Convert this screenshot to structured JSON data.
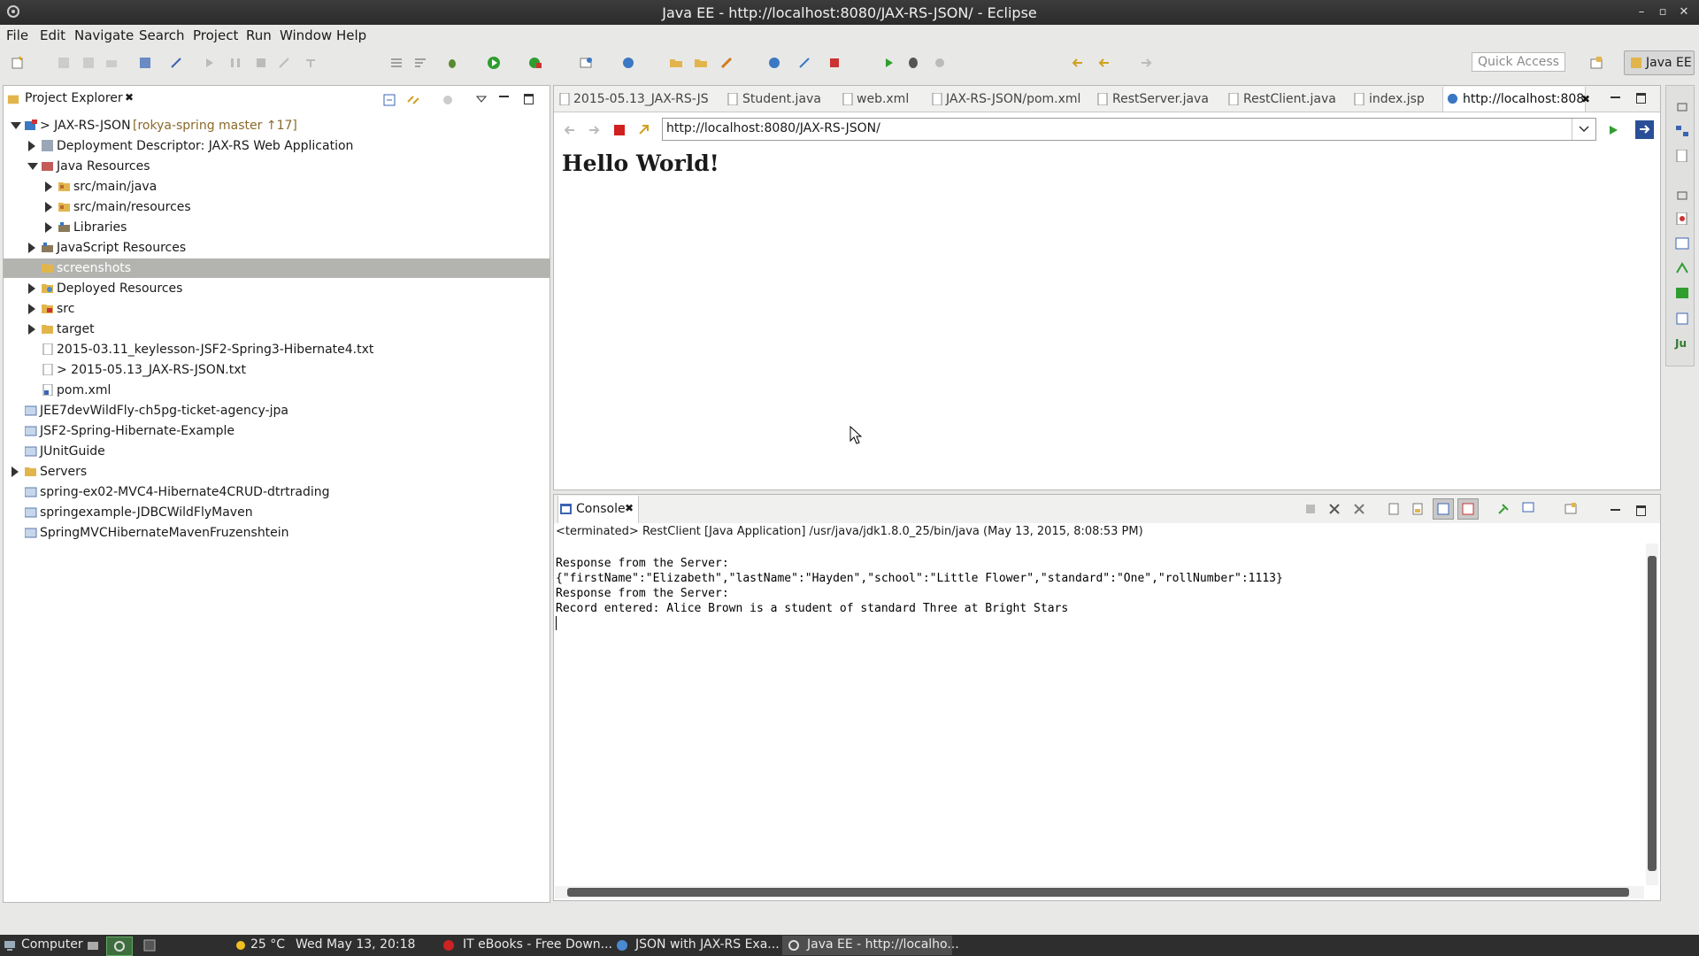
{
  "window": {
    "title": "Java EE - http://localhost:8080/JAX-RS-JSON/ - Eclipse"
  },
  "menu": [
    "File",
    "Edit",
    "Navigate",
    "Search",
    "Project",
    "Run",
    "Window",
    "Help"
  ],
  "toolbar": {
    "quick_access_placeholder": "Quick Access",
    "perspective": "Java EE"
  },
  "project_explorer": {
    "tab_label": "Project Explorer",
    "items": [
      {
        "label": "> JAX-RS-JSON",
        "extra": "[rokya-spring master ↑17]"
      },
      {
        "label": "Deployment Descriptor: JAX-RS Web Application"
      },
      {
        "label": "Java Resources"
      },
      {
        "label": "src/main/java"
      },
      {
        "label": "src/main/resources"
      },
      {
        "label": "Libraries"
      },
      {
        "label": "JavaScript Resources"
      },
      {
        "label": "screenshots"
      },
      {
        "label": "Deployed Resources"
      },
      {
        "label": "src"
      },
      {
        "label": "target"
      },
      {
        "label": "2015-03.11_keylesson-JSF2-Spring3-Hibernate4.txt"
      },
      {
        "label": "> 2015-05.13_JAX-RS-JSON.txt"
      },
      {
        "label": "pom.xml"
      },
      {
        "label": "JEE7devWildFly-ch5pg-ticket-agency-jpa"
      },
      {
        "label": "JSF2-Spring-Hibernate-Example"
      },
      {
        "label": "JUnitGuide"
      },
      {
        "label": "Servers"
      },
      {
        "label": "spring-ex02-MVC4-Hibernate4CRUD-dtrtrading"
      },
      {
        "label": "springexample-JDBCWildFlyMaven"
      },
      {
        "label": "SpringMVCHibernateMavenFruzenshtein"
      }
    ]
  },
  "editor": {
    "tabs": [
      "2015-05.13_JAX-RS-JS",
      "Student.java",
      "web.xml",
      "JAX-RS-JSON/pom.xml",
      "RestServer.java",
      "RestClient.java",
      "index.jsp",
      "http://localhost:808"
    ],
    "url": "http://localhost:8080/JAX-RS-JSON/",
    "page_heading": "Hello World!"
  },
  "console": {
    "tab_label": "Console",
    "status": "<terminated> RestClient [Java Application] /usr/java/jdk1.8.0_25/bin/java (May 13, 2015, 8:08:53 PM)",
    "lines": [
      "Response from the Server:",
      "{\"firstName\":\"Elizabeth\",\"lastName\":\"Hayden\",\"school\":\"Little Flower\",\"standard\":\"One\",\"rollNumber\":1113}",
      "Response from the Server:",
      "Record entered: Alice Brown is a student of standard Three at Bright Stars"
    ]
  },
  "taskbar": {
    "start": "Computer",
    "weather": "25 °C",
    "clock": "Wed May 13, 20:18",
    "windows": [
      "IT eBooks - Free Down...",
      "JSON with JAX-RS Exa...",
      "Java EE - http://localho..."
    ]
  }
}
